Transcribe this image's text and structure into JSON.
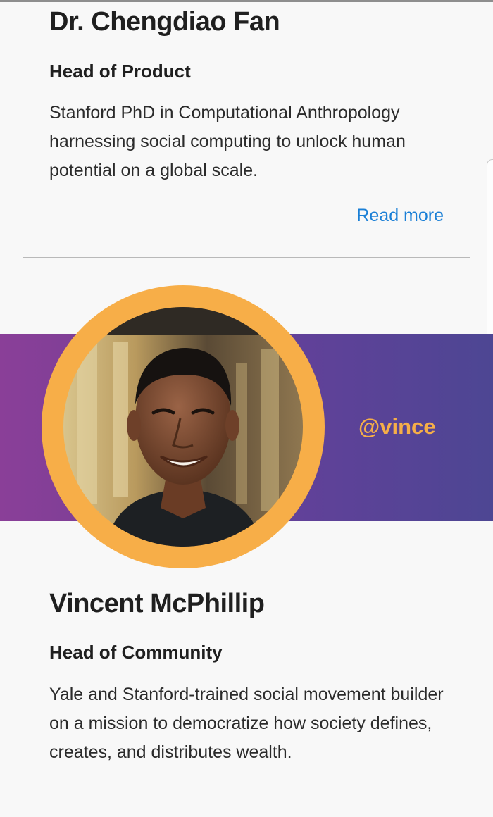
{
  "profiles": [
    {
      "name": "Dr. Chengdiao Fan",
      "role": "Head of Product",
      "bio": "Stanford PhD in Computational Anthropology harnessing social computing to unlock human potential on a global scale.",
      "read_more": "Read more"
    },
    {
      "handle": "@vince",
      "name": "Vincent McPhillip",
      "role": "Head of Community",
      "bio": "Yale and Stanford-trained social movement builder on a mission to democratize how society defines, creates, and distributes wealth."
    }
  ],
  "colors": {
    "banner_start": "#8a3f98",
    "banner_end": "#4d4693",
    "accent_orange": "#f7ae48",
    "link_blue": "#1a7fd6"
  }
}
